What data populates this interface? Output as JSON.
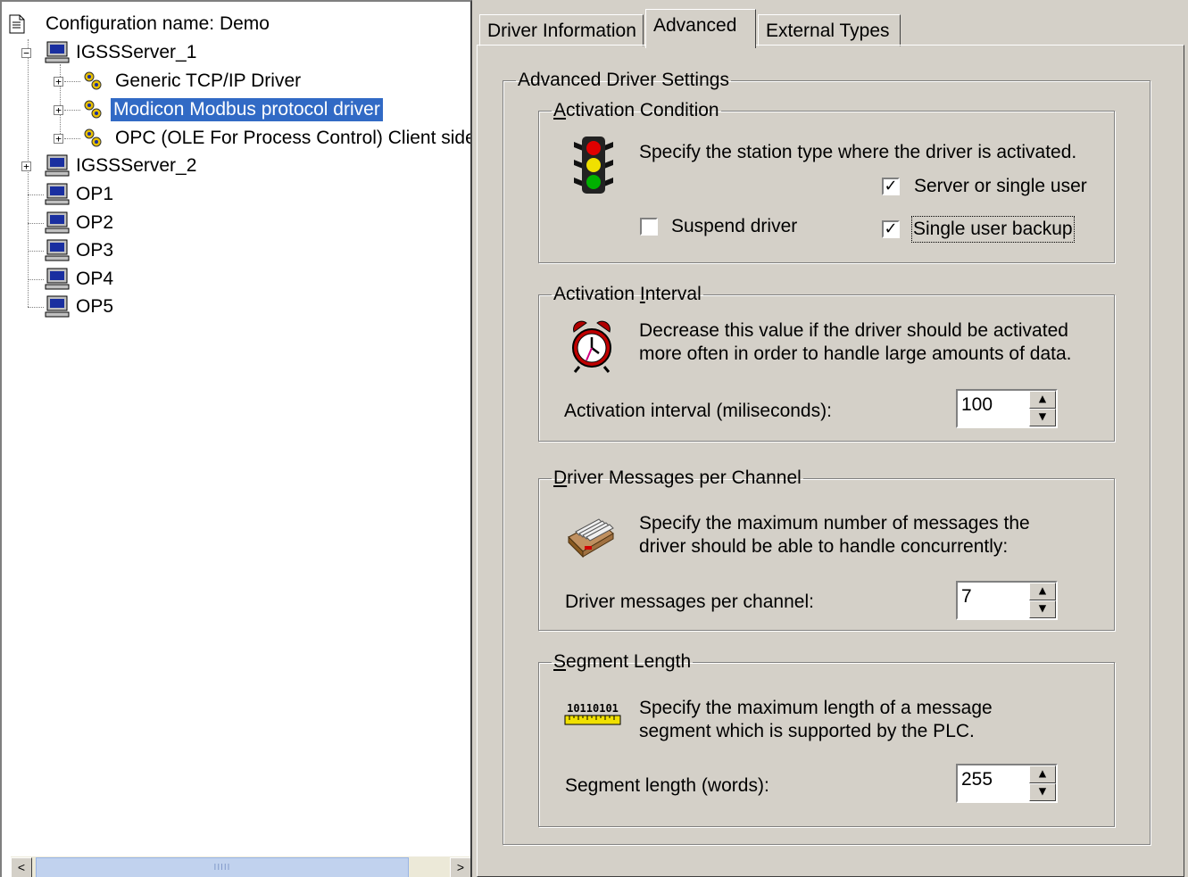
{
  "tree": {
    "root_label": "Configuration name: Demo",
    "nodes": [
      {
        "label": "IGSSServer_1",
        "expander": "−",
        "icon": "computer-icon"
      },
      {
        "label": "Generic TCP/IP Driver",
        "expander": "+",
        "icon": "driver-icon"
      },
      {
        "label": "Modicon Modbus protocol driver",
        "expander": "+",
        "icon": "driver-icon",
        "selected": true
      },
      {
        "label": "OPC (OLE For Process Control) Client side",
        "expander": "+",
        "icon": "driver-icon"
      },
      {
        "label": "IGSSServer_2",
        "expander": "+",
        "icon": "computer-icon"
      },
      {
        "label": "OP1",
        "icon": "computer-icon"
      },
      {
        "label": "OP2",
        "icon": "computer-icon"
      },
      {
        "label": "OP3",
        "icon": "computer-icon"
      },
      {
        "label": "OP4",
        "icon": "computer-icon"
      },
      {
        "label": "OP5",
        "icon": "computer-icon"
      }
    ],
    "scroll_left": "<",
    "scroll_right": ">",
    "scroll_thumb": "IIIII"
  },
  "tabs": [
    {
      "label": "Driver Information",
      "active": false
    },
    {
      "label": "Advanced",
      "active": true
    },
    {
      "label": "External Types",
      "active": false
    }
  ],
  "advanced": {
    "group_title": "Advanced Driver Settings",
    "activation_condition": {
      "title_u": "A",
      "title_rest": "ctivation Condition",
      "description": "Specify the station type where the driver is activated.",
      "icon": "traffic-light-icon",
      "server_or_single_user": {
        "label": "Server or single user",
        "checked": true,
        "mark": "✓"
      },
      "suspend_driver": {
        "label": "Suspend driver",
        "checked": false,
        "mark": ""
      },
      "single_user_backup": {
        "label": "Single user backup",
        "checked": true,
        "mark": "✓"
      }
    },
    "activation_interval": {
      "title_pre": "Activation ",
      "title_u": "I",
      "title_rest": "nterval",
      "description_line1": "Decrease this value if the driver should be activated",
      "description_line2": "more often in order to handle large amounts of data.",
      "icon": "alarm-clock-icon",
      "field_label": "Activation interval (miliseconds):",
      "value": "100"
    },
    "driver_messages": {
      "title_u": "D",
      "title_rest": "river Messages per Channel",
      "description_line1": "Specify the maximum number of messages the",
      "description_line2": "driver should be able to handle concurrently:",
      "icon": "message-tray-icon",
      "field_label": "Driver messages per channel:",
      "value": "7"
    },
    "segment_length": {
      "title_u": "S",
      "title_rest": "egment Length",
      "description_line1": "Specify the maximum length of a message",
      "description_line2": "segment which is supported by the PLC.",
      "icon": "ruler-icon",
      "icon_text": "10110101",
      "field_label": "Segment length (words):",
      "value": "255"
    },
    "spin_up": "▲",
    "spin_down": "▼"
  }
}
